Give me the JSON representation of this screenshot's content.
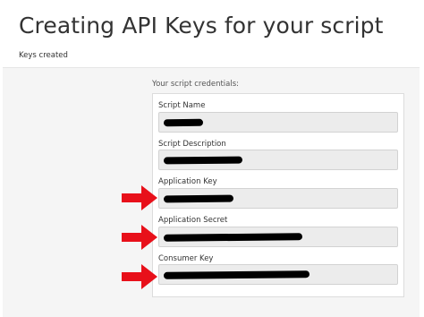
{
  "page": {
    "title": "Creating API Keys for your script",
    "subtitle": "Keys created"
  },
  "credentials": {
    "heading": "Your script credentials:",
    "fields": [
      {
        "label": "Script Name",
        "value_redacted": true,
        "highlighted": false
      },
      {
        "label": "Script Description",
        "value_redacted": true,
        "highlighted": false
      },
      {
        "label": "Application Key",
        "value_redacted": true,
        "highlighted": true
      },
      {
        "label": "Application Secret",
        "value_redacted": true,
        "highlighted": true
      },
      {
        "label": "Consumer Key",
        "value_redacted": true,
        "highlighted": true
      }
    ]
  },
  "colors": {
    "arrow": "#e8101a",
    "redaction": "#000000",
    "field_background": "#ececec",
    "panel_background": "#f5f5f5"
  },
  "icons": {
    "pointer": "right-arrow-icon"
  }
}
